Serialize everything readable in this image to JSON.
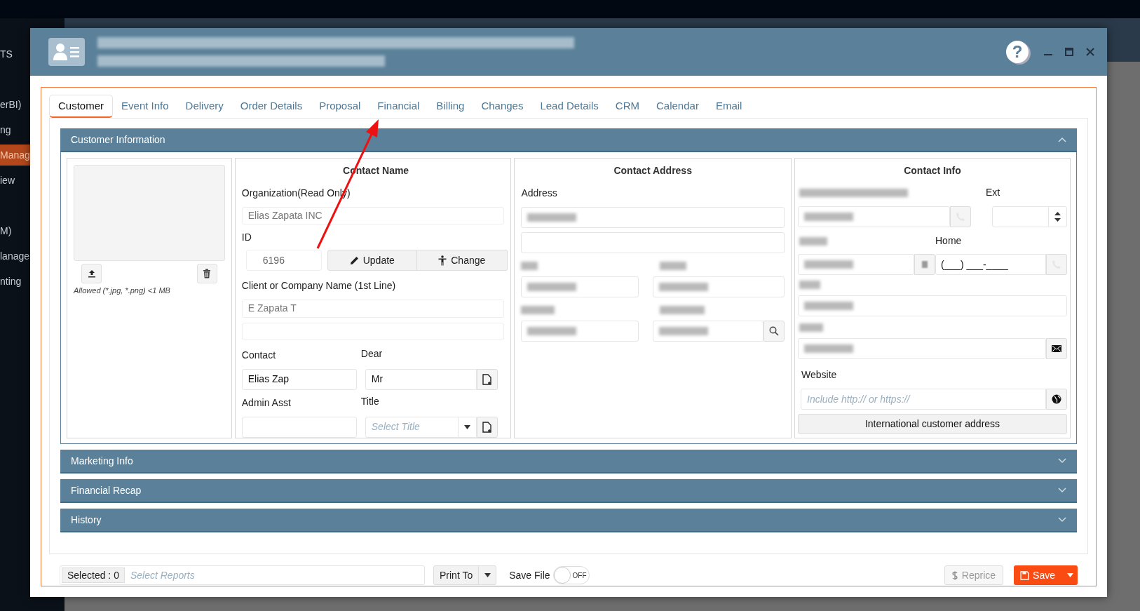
{
  "background": {
    "sidebar_items": [
      {
        "label": "TS",
        "selected": false
      },
      {
        "label": "erBI)",
        "selected": false
      },
      {
        "label": "ng",
        "selected": false
      },
      {
        "label": "Manag",
        "selected": true
      },
      {
        "label": "iew",
        "selected": false
      },
      {
        "label": "M)",
        "selected": false
      },
      {
        "label": "lanage",
        "selected": false
      },
      {
        "label": "nting",
        "selected": false
      }
    ]
  },
  "dialog": {
    "help_glyph": "?",
    "tabs": [
      {
        "label": "Customer",
        "selected": true
      },
      {
        "label": "Event Info",
        "selected": false
      },
      {
        "label": "Delivery",
        "selected": false
      },
      {
        "label": "Order Details",
        "selected": false
      },
      {
        "label": "Proposal",
        "selected": false
      },
      {
        "label": "Financial",
        "selected": false
      },
      {
        "label": "Billing",
        "selected": false
      },
      {
        "label": "Changes",
        "selected": false
      },
      {
        "label": "Lead Details",
        "selected": false
      },
      {
        "label": "CRM",
        "selected": false
      },
      {
        "label": "Calendar",
        "selected": false
      },
      {
        "label": "Email",
        "selected": false
      }
    ],
    "sections": [
      {
        "title": "Customer Information",
        "expanded": true
      },
      {
        "title": "Marketing Info",
        "expanded": false
      },
      {
        "title": "Financial Recap",
        "expanded": false
      },
      {
        "title": "History",
        "expanded": false
      }
    ],
    "photo": {
      "upload_hint": "Allowed (*.jpg, *.png) <1 MB"
    },
    "contact_name": {
      "heading": "Contact Name",
      "organization_label": "Organization(Read Only)",
      "organization_value": "Elias Zapata INC",
      "id_label": "ID",
      "id_value": "6196",
      "update_button": "Update",
      "change_button": "Change",
      "company_label": "Client or Company Name (1st Line)",
      "company_value": "E Zapata T",
      "contact_label": "Contact",
      "contact_value": "Elias Zap",
      "dear_label": "Dear",
      "dear_value": "Mr",
      "admin_label": "Admin Asst",
      "title_label": "Title",
      "title_placeholder": "Select Title"
    },
    "contact_address": {
      "heading": "Contact Address",
      "address_label": "Address"
    },
    "contact_info": {
      "heading": "Contact Info",
      "ext_label": "Ext",
      "home_label": "Home",
      "home_value": "(___) ___-____",
      "website_label": "Website",
      "website_placeholder": "Include http:// or https://",
      "intl_button": "International customer address"
    },
    "footer": {
      "selected_badge": "Selected : 0",
      "reports_placeholder": "Select Reports",
      "print_button": "Print To",
      "save_file_label": "Save File",
      "save_file_toggle": {
        "on": false,
        "label": "OFF"
      },
      "reprice_button": {
        "label": "Reprice",
        "disabled": true
      },
      "save_button": "Save"
    }
  }
}
